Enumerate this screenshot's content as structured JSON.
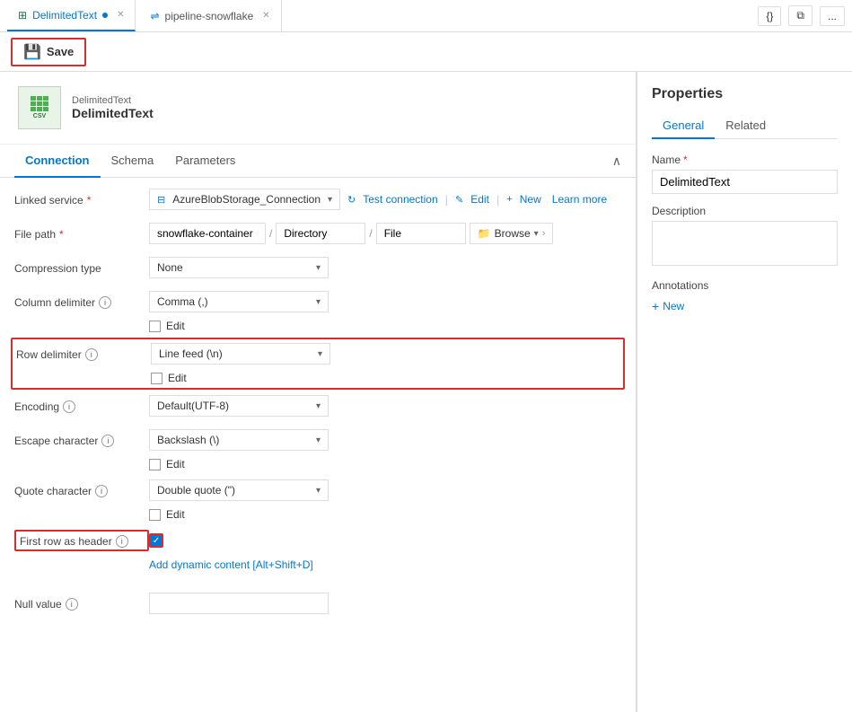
{
  "tabs": [
    {
      "id": "delimited",
      "label": "DelimitedText",
      "icon": "csv",
      "active": true
    },
    {
      "id": "pipeline",
      "label": "pipeline-snowflake",
      "icon": "pipeline",
      "active": false
    }
  ],
  "toolbar": {
    "save_label": "Save",
    "code_btn": "{}",
    "copy_btn": "⧉",
    "more_btn": "..."
  },
  "dataset": {
    "type_label": "DelimitedText",
    "name_label": "DelimitedText"
  },
  "section_tabs": [
    "Connection",
    "Schema",
    "Parameters"
  ],
  "active_section": "Connection",
  "form": {
    "linked_service": {
      "label": "Linked service",
      "required": true,
      "value": "AzureBlobStorage_Connection",
      "actions": [
        "Test connection",
        "Edit",
        "New",
        "Learn more"
      ]
    },
    "file_path": {
      "label": "File path",
      "required": true,
      "container": "snowflake-container",
      "directory": "Directory",
      "file": "File"
    },
    "compression_type": {
      "label": "Compression type",
      "value": "None"
    },
    "column_delimiter": {
      "label": "Column delimiter",
      "value": "Comma (,)",
      "has_info": true,
      "edit_checkbox": false,
      "edit_label": "Edit"
    },
    "row_delimiter": {
      "label": "Row delimiter",
      "value": "Line feed (\\n)",
      "has_info": true,
      "edit_checkbox": false,
      "edit_label": "Edit",
      "highlighted": true
    },
    "encoding": {
      "label": "Encoding",
      "value": "Default(UTF-8)",
      "has_info": true
    },
    "escape_character": {
      "label": "Escape character",
      "value": "Backslash (\\)",
      "has_info": true,
      "edit_checkbox": false,
      "edit_label": "Edit"
    },
    "quote_character": {
      "label": "Quote character",
      "value": "Double quote (\")",
      "has_info": true,
      "edit_checkbox": false,
      "edit_label": "Edit"
    },
    "first_row_header": {
      "label": "First row as header",
      "has_info": true,
      "checked": true,
      "highlighted": true
    },
    "dynamic_content": {
      "label": "Add dynamic content [Alt+Shift+D]"
    },
    "null_value": {
      "label": "Null value",
      "has_info": true,
      "value": ""
    }
  },
  "properties": {
    "title": "Properties",
    "tabs": [
      "General",
      "Related"
    ],
    "active_tab": "General",
    "name_label": "Name",
    "name_required": true,
    "name_value": "DelimitedText",
    "description_label": "Description",
    "description_value": "",
    "annotations_label": "Annotations",
    "add_annotation_label": "New"
  },
  "colors": {
    "accent": "#0078d4",
    "danger": "#d32f2f",
    "border": "#ddd"
  }
}
